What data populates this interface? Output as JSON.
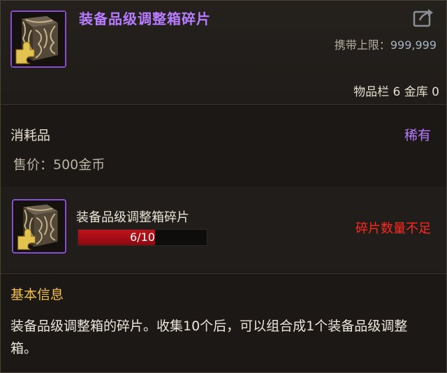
{
  "item": {
    "name": "装备品级调整箱碎片",
    "carry_limit_label": "携带上限：",
    "carry_limit_value": "999,999",
    "inventory_label": "物品栏",
    "inventory_count": "6",
    "storage_label": "金库",
    "storage_count": "0",
    "type": "消耗品",
    "rarity": "稀有",
    "price": "售价：500金币"
  },
  "fragment": {
    "name": "装备品级调整箱碎片",
    "progress_text": "6/10",
    "progress_current": 6,
    "progress_total": 10,
    "status": "碎片数量不足"
  },
  "info": {
    "title": "基本信息",
    "description": "装备品级调整箱的碎片。收集10个后，可以组合成1个装备品级调整箱。"
  },
  "colors": {
    "rarity_purple": "#b77cff",
    "warning_red": "#ff2a1e",
    "section_gold": "#f2c04a",
    "progress_red": "#c0121a"
  },
  "icons": {
    "item": "ornate-box-fragment-icon",
    "share": "share-export-icon"
  }
}
